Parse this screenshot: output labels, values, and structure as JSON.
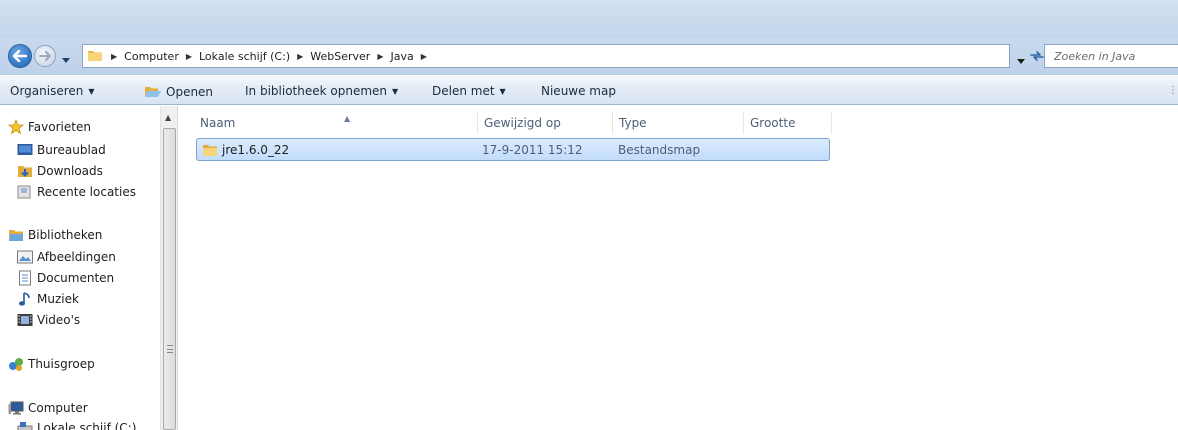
{
  "address": {
    "crumbs": [
      "Computer",
      "Lokale schijf (C:)",
      "WebServer",
      "Java"
    ]
  },
  "search": {
    "placeholder": "Zoeken in Java"
  },
  "toolbar": {
    "organize": "Organiseren",
    "open": "Openen",
    "library": "In bibliotheek opnemen",
    "share": "Delen met",
    "new_folder": "Nieuwe map"
  },
  "sidebar": {
    "favorites": "Favorieten",
    "favorite_items": [
      "Bureaublad",
      "Downloads",
      "Recente locaties"
    ],
    "libraries": "Bibliotheken",
    "library_items": [
      "Afbeeldingen",
      "Documenten",
      "Muziek",
      "Video's"
    ],
    "homegroup": "Thuisgroep",
    "computer": "Computer",
    "computer_items": [
      "Lokale schijf (C:)"
    ]
  },
  "columns": {
    "name": "Naam",
    "modified": "Gewijzigd op",
    "type": "Type",
    "size": "Grootte"
  },
  "files": [
    {
      "name": "jre1.6.0_22",
      "modified": "17-9-2011 15:12",
      "type": "Bestandsmap",
      "size": ""
    }
  ],
  "colors": {
    "selection": "#cce4fd",
    "selection_border": "#7da2ce",
    "frame": "#c9daee"
  }
}
